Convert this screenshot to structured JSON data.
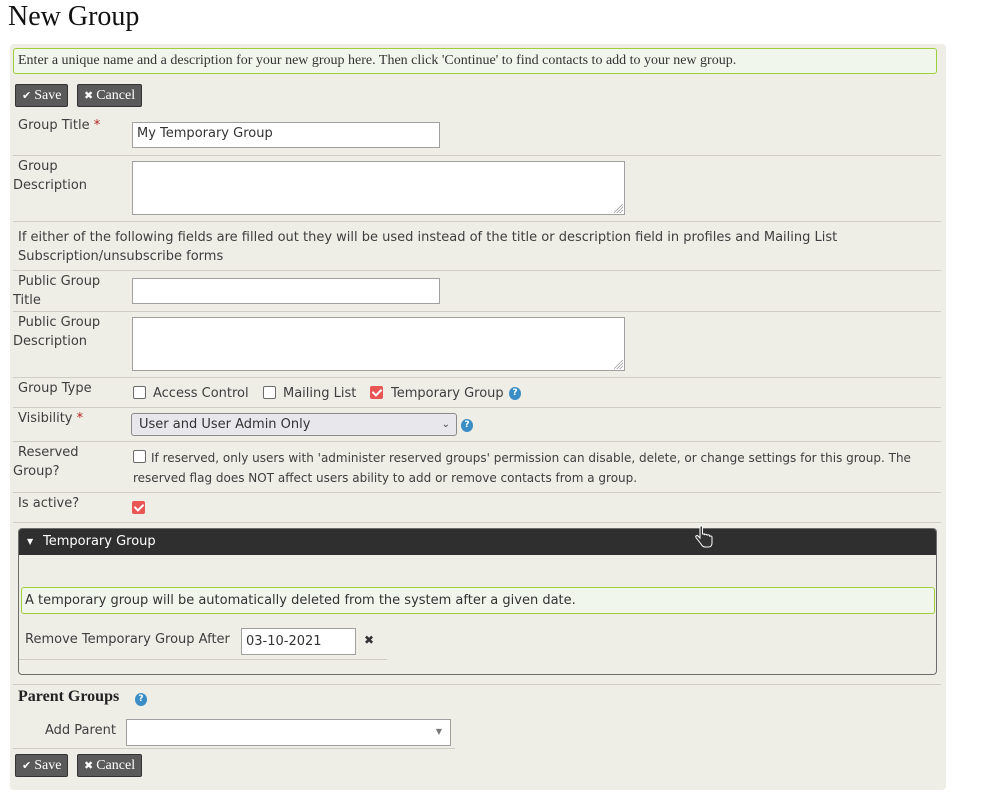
{
  "page": {
    "title": "New Group"
  },
  "help_text": "Enter a unique name and a description for your new group here. Then click 'Continue' to find contacts to add to your new group.",
  "buttons": {
    "save": "Save",
    "cancel": "Cancel",
    "save_icon": "check-icon",
    "cancel_icon": "times-icon"
  },
  "form": {
    "group_title": {
      "label": "Group Title",
      "required": "*",
      "value": "My Temporary Group"
    },
    "group_description": {
      "label_line1": "Group",
      "label_line2": "Description",
      "value": ""
    },
    "public_note": "If either of the following fields are filled out they will be used instead of the title or description field in profiles and Mailing List Subscription/unsubscribe forms",
    "public_title": {
      "label_line1": "Public Group",
      "label_line2": "Title",
      "value": ""
    },
    "public_description": {
      "label_line1": "Public Group",
      "label_line2": "Description",
      "value": ""
    },
    "group_type": {
      "label": "Group Type",
      "options": [
        {
          "label": "Access Control",
          "checked": false
        },
        {
          "label": "Mailing List",
          "checked": false
        },
        {
          "label": "Temporary Group",
          "checked": true
        }
      ]
    },
    "visibility": {
      "label": "Visibility",
      "required": "*",
      "selected": "User and User Admin Only"
    },
    "reserved": {
      "label_line1": "Reserved",
      "label_line2": "Group?",
      "checked": false,
      "desc_line1": "If reserved, only users with 'administer reserved groups' permission can disable, delete, or change settings for this group. The",
      "desc_line2": "reserved flag does NOT affect users ability to add or remove contacts from a group."
    },
    "is_active": {
      "label": "Is active?",
      "checked": true
    }
  },
  "temporary_group": {
    "header": "Temporary Group",
    "help": "A temporary group will be automatically deleted from the system after a given date.",
    "remove_after": {
      "label": "Remove Temporary Group After",
      "value": "03-10-2021"
    }
  },
  "parent_groups": {
    "title": "Parent Groups",
    "add_parent_label": "Add Parent",
    "add_parent_value": ""
  }
}
